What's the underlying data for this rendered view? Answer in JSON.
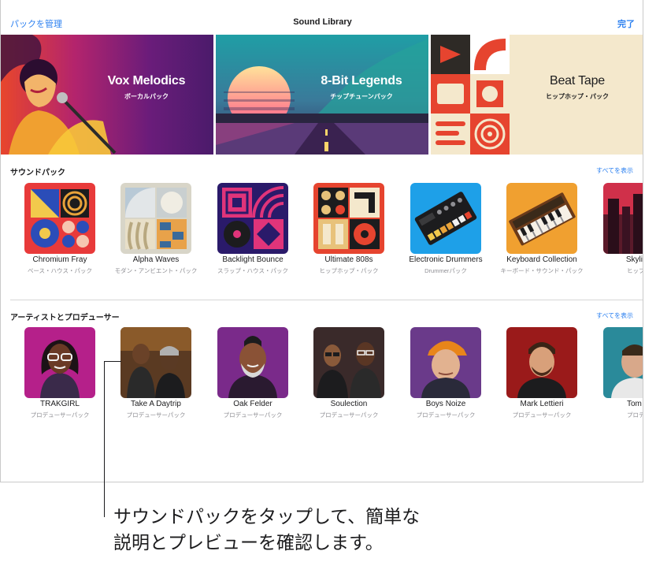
{
  "navbar": {
    "left_label": "パックを管理",
    "title": "Sound Library",
    "right_label": "完了"
  },
  "banners": [
    {
      "title": "Vox Melodics",
      "subtitle": "ボーカルパック",
      "color": "#ffffff"
    },
    {
      "title": "8-Bit Legends",
      "subtitle": "チップチューンパック",
      "color": "#ffffff"
    },
    {
      "title": "Beat Tape",
      "subtitle": "ヒップホップ・パック",
      "color": "#1c1c1e"
    }
  ],
  "sound_packs": {
    "header": "サウンドパック",
    "see_all": "すべてを表示",
    "items": [
      {
        "name": "Chromium Fray",
        "subtitle": "ベース・ハウス・パック"
      },
      {
        "name": "Alpha Waves",
        "subtitle": "モダン・アンビエント・パック"
      },
      {
        "name": "Backlight Bounce",
        "subtitle": "スラップ・ハウス・パック"
      },
      {
        "name": "Ultimate 808s",
        "subtitle": "ヒップホップ・パック"
      },
      {
        "name": "Electronic Drummers",
        "subtitle": "Drummerパック"
      },
      {
        "name": "Keyboard Collection",
        "subtitle": "キーボード・サウンド・パック"
      },
      {
        "name": "Skyline",
        "subtitle": "ヒップホ"
      }
    ]
  },
  "artists": {
    "header": "アーティストとプロデューサー",
    "see_all": "すべてを表示",
    "items": [
      {
        "name": "TRAKGIRL",
        "subtitle": "プロデューサーパック"
      },
      {
        "name": "Take A Daytrip",
        "subtitle": "プロデューサーパック"
      },
      {
        "name": "Oak Felder",
        "subtitle": "プロデューサーパック"
      },
      {
        "name": "Soulection",
        "subtitle": "プロデューサーパック"
      },
      {
        "name": "Boys Noize",
        "subtitle": "プロデューサーパック"
      },
      {
        "name": "Mark Lettieri",
        "subtitle": "プロデューサーパック"
      },
      {
        "name": "Tom M",
        "subtitle": "プロデュ"
      }
    ]
  },
  "callout": {
    "line1": "サウンドパックをタップして、簡単な",
    "line2": "説明とプレビューを確認します。"
  }
}
